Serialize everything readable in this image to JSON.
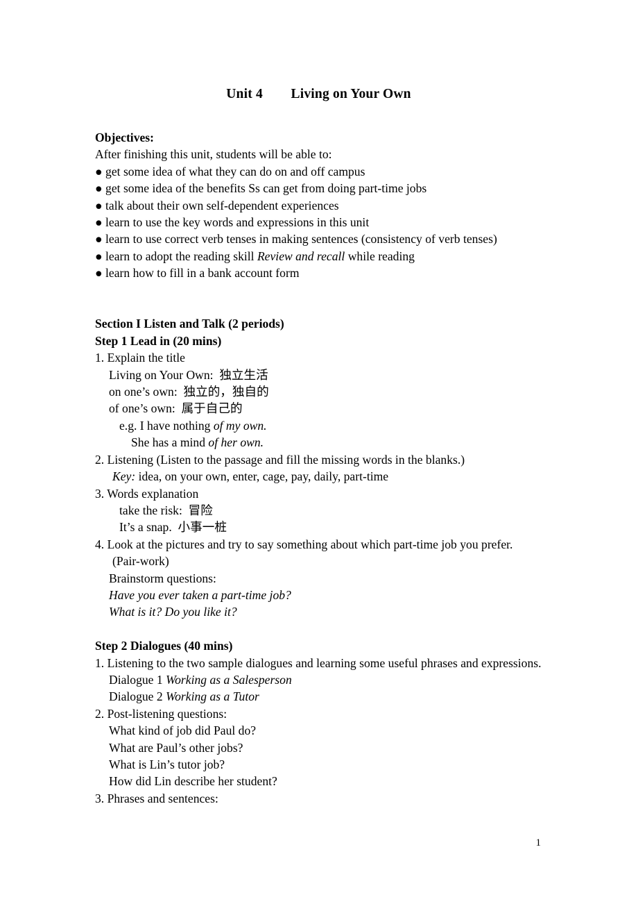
{
  "document": {
    "title_left": "Unit 4",
    "title_right": "Living on Your Own",
    "page_number": "1"
  },
  "objectives": {
    "heading": "Objectives:",
    "intro": "After finishing this unit, students will be able to:",
    "bullet_char": "●",
    "items": [
      "get some idea of what they can do on and off campus",
      "get some idea of the benefits Ss can get from doing part-time jobs",
      "talk about their own self-dependent experiences",
      "learn to use the key words and expressions in this unit",
      "learn to use correct verb tenses in making sentences (consistency of verb tenses)",
      "learn how to fill in a bank account form"
    ],
    "item_reading_skill": {
      "before": "learn to adopt the reading skill ",
      "italic": "Review and recall",
      "after": " while reading"
    }
  },
  "section_one": {
    "heading": "Section I Listen and Talk (2 periods)",
    "step1": {
      "heading": "Step 1 Lead in (20 mins)",
      "item1": {
        "number": "1. Explain the title",
        "sub": [
          "Living on Your Own:  独立生活",
          "on one’s own:  独立的，独自的",
          "of one’s own:  属于自己的"
        ],
        "eg1_before": "e.g. I have nothing ",
        "eg1_italic": "of my own.",
        "eg2_before": "She has a mind ",
        "eg2_italic": "of her own."
      },
      "item2": {
        "number": "2. Listening (Listen to the passage and fill the missing words in the blanks.)",
        "key_label": "Key:",
        "key_value": " idea, on your own, enter, cage, pay, daily, part-time"
      },
      "item3": {
        "number": "3. Words explanation",
        "sub": [
          "take the risk:  冒险",
          "It’s a snap.  小事一桩"
        ]
      },
      "item4": {
        "number": "4. Look at the pictures and try to say something about which part-time job you prefer.",
        "pair_work": "(Pair-work)",
        "brainstorm_label": "Brainstorm questions:",
        "questions": [
          "Have you ever taken a part-time job?",
          "What is it? Do you like it?"
        ]
      }
    },
    "step2": {
      "heading": "Step 2 Dialogues (40 mins)",
      "item1": "1.  Listening to the two sample dialogues and learning some useful phrases and expressions.",
      "dialogue1_label": "Dialogue 1 ",
      "dialogue1_title": "Working as a Salesperson",
      "dialogue2_label": "Dialogue 2 ",
      "dialogue2_title": "Working as a Tutor",
      "item2": {
        "number": "2. Post-listening questions:",
        "questions": [
          "What kind of job did Paul do?",
          "What are Paul’s other jobs?",
          "What is Lin’s tutor job?",
          "How did Lin describe her student?"
        ]
      },
      "item3": "3. Phrases and sentences:"
    }
  }
}
